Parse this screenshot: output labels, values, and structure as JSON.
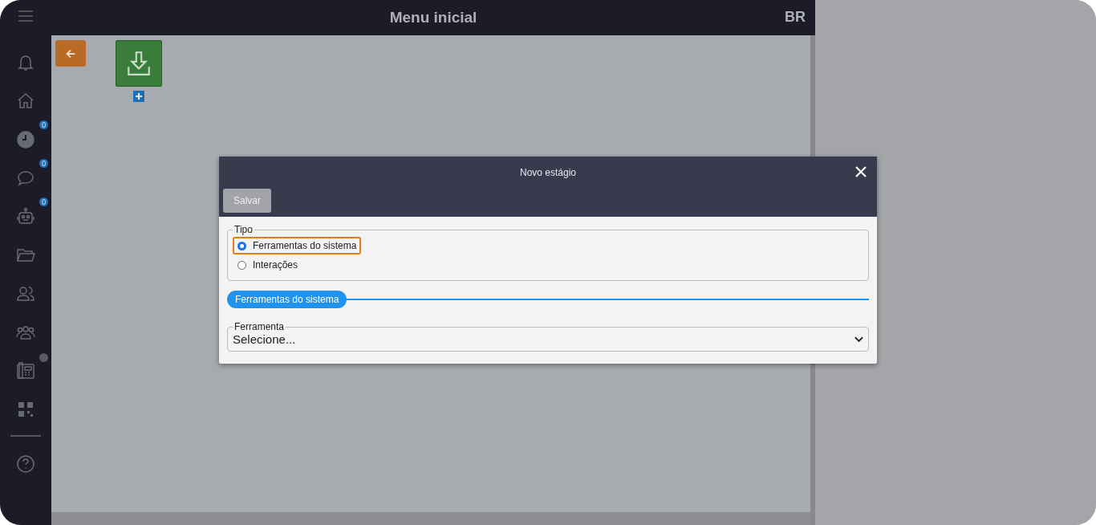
{
  "header": {
    "title": "Menu inicial",
    "language": "BR"
  },
  "sidebar": {
    "items": [
      {
        "kind": "bell"
      },
      {
        "kind": "home"
      },
      {
        "kind": "clock",
        "badge": "0"
      },
      {
        "kind": "chat",
        "badge": "0"
      },
      {
        "kind": "robot",
        "badge": "0"
      },
      {
        "kind": "folder"
      },
      {
        "kind": "users"
      },
      {
        "kind": "group"
      },
      {
        "kind": "phone",
        "status_dot": true
      },
      {
        "kind": "qr"
      }
    ],
    "footer_items": [
      {
        "kind": "help"
      }
    ]
  },
  "modal": {
    "title": "Novo estágio",
    "save_button": "Salvar",
    "type_group": {
      "legend": "Tipo",
      "options": [
        {
          "label": "Ferramentas do sistema",
          "selected": true
        },
        {
          "label": "Interações",
          "selected": false
        }
      ]
    },
    "section_label": "Ferramentas do sistema",
    "tool_field": {
      "legend": "Ferramenta",
      "value": "Selecione..."
    }
  }
}
